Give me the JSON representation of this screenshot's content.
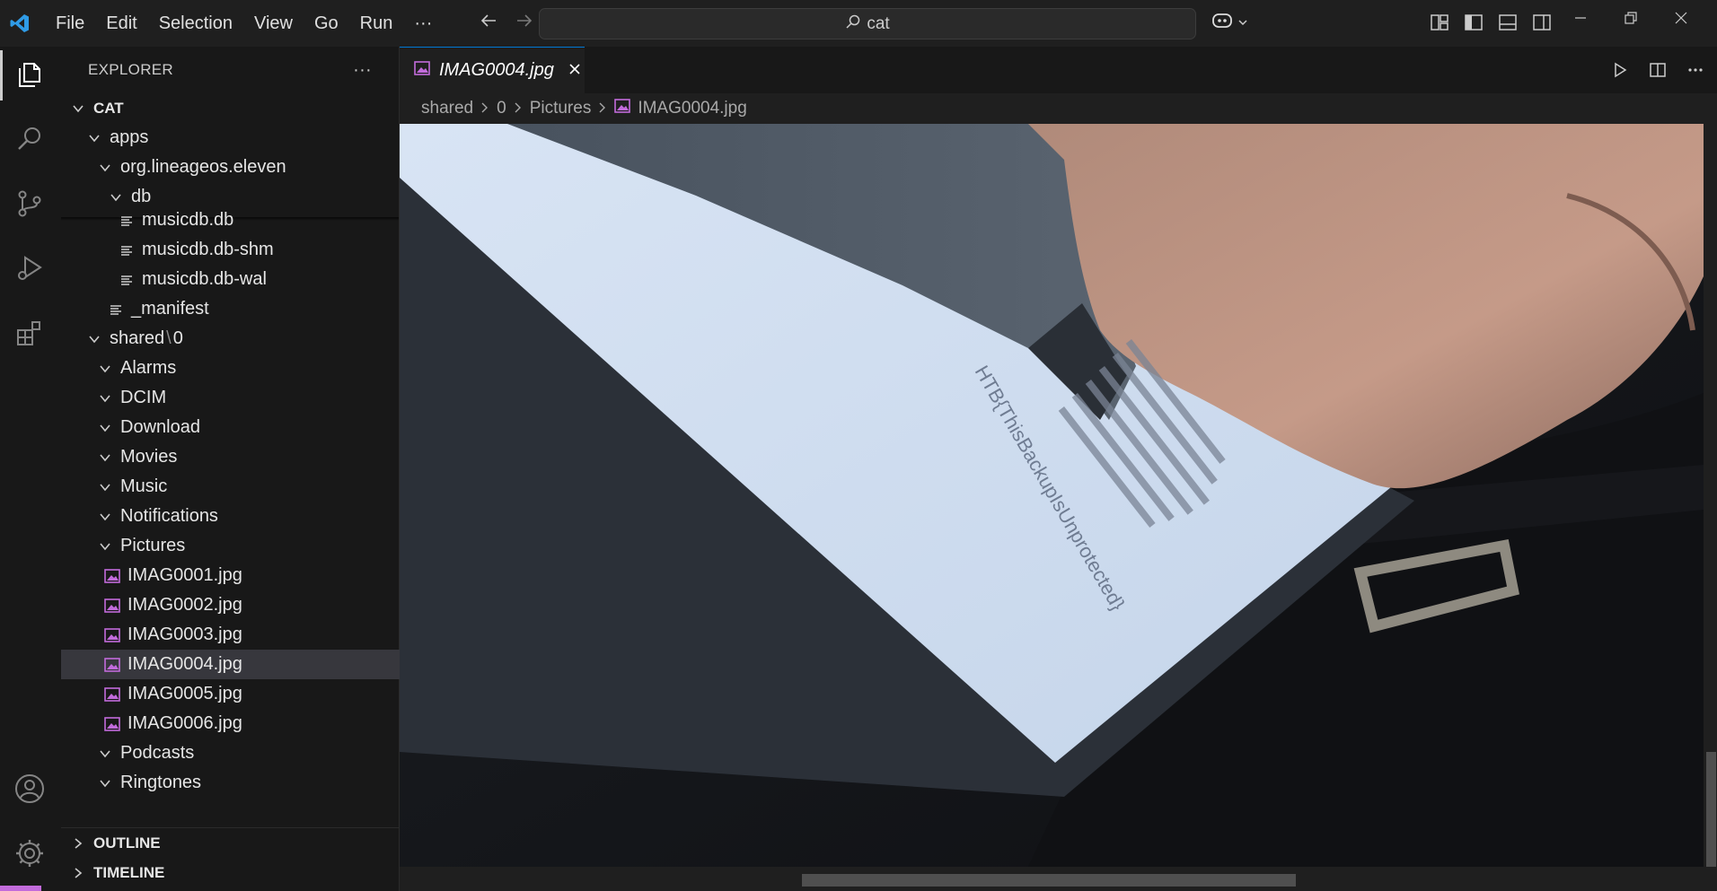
{
  "titlebar": {
    "menu": [
      "File",
      "Edit",
      "Selection",
      "View",
      "Go",
      "Run",
      "···"
    ],
    "search": "cat"
  },
  "explorer": {
    "title": "EXPLORER",
    "more": "···",
    "root": "CAT",
    "items": {
      "apps": "apps",
      "org": "org.lineageos.eleven",
      "db": "db",
      "musicdb": "musicdb.db",
      "musicdb_shm": "musicdb.db-shm",
      "musicdb_wal": "musicdb.db-wal",
      "manifest": "_manifest",
      "shared": "shared",
      "shared_sep": "\\",
      "shared_sub": "0",
      "alarms": "Alarms",
      "dcim": "DCIM",
      "download": "Download",
      "movies": "Movies",
      "music": "Music",
      "notifications": "Notifications",
      "pictures": "Pictures",
      "img1": "IMAG0001.jpg",
      "img2": "IMAG0002.jpg",
      "img3": "IMAG0003.jpg",
      "img4": "IMAG0004.jpg",
      "img5": "IMAG0005.jpg",
      "img6": "IMAG0006.jpg",
      "podcasts": "Podcasts",
      "ringtones": "Ringtones"
    },
    "outline": "OUTLINE",
    "timeline": "TIMELINE"
  },
  "editor": {
    "tab_label": "IMAG0004.jpg",
    "breadcrumb": [
      "shared",
      "0",
      "Pictures",
      "IMAG0004.jpg"
    ],
    "image_text": "HTB{ThisBackupIsUnprotected}"
  },
  "colors": {
    "accent": "#0078d4",
    "image_icon": "#c26bdb",
    "status_accent": "#c26bdb"
  }
}
